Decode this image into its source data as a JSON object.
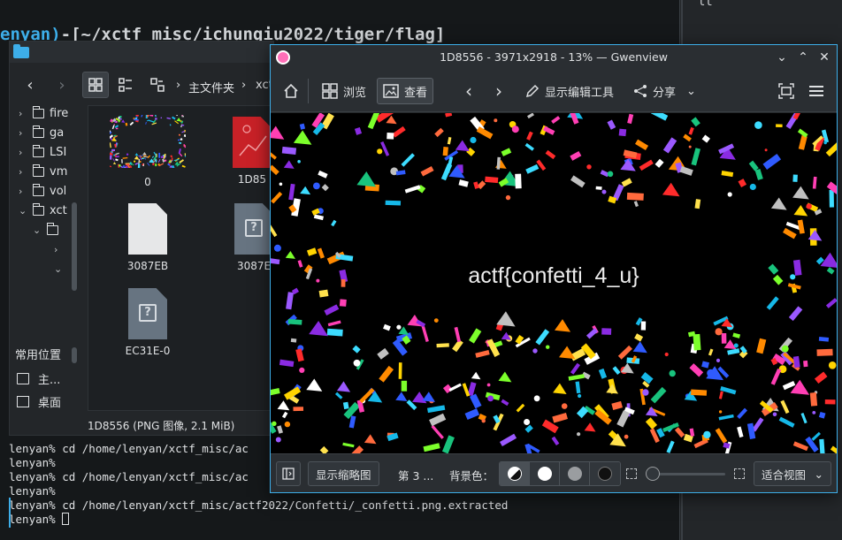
{
  "background_terminal": {
    "prompt_user": "enyan)",
    "prompt_path": "-[~/xctf_misc/ichunqiu2022/tiger/flag]",
    "right_pane_text": "lt"
  },
  "dolphin": {
    "breadcrumb_home": "主文件夹",
    "breadcrumb_next": "xct",
    "tree": [
      {
        "label": "fire",
        "expanded": false
      },
      {
        "label": "ga",
        "expanded": false
      },
      {
        "label": "LSI",
        "expanded": false
      },
      {
        "label": "vm",
        "expanded": false
      },
      {
        "label": "vol",
        "expanded": false
      },
      {
        "label": "xct",
        "expanded": true
      }
    ],
    "places_title": "常用位置",
    "places": [
      {
        "label": "主..."
      },
      {
        "label": "桌面"
      }
    ],
    "files": [
      {
        "name": "0",
        "kind": "thumbnail"
      },
      {
        "name": "1D85",
        "kind": "image-red"
      },
      {
        "name": "3087EB",
        "kind": "white-doc"
      },
      {
        "name": "3087E",
        "kind": "gray-unknown"
      },
      {
        "name": "EC31E-0",
        "kind": "gray-unknown"
      }
    ],
    "status": "1D8556 (PNG 图像, 2.1 MiB)"
  },
  "terminal": {
    "lines": [
      "lenyan%  cd /home/lenyan/xctf_misc/ac",
      "lenyan%",
      "lenyan%  cd /home/lenyan/xctf_misc/ac",
      "lenyan%",
      "lenyan%  cd /home/lenyan/xctf_misc/actf2022/Confetti/_confetti.png.extracted",
      "lenyan%"
    ]
  },
  "gwenview": {
    "title": "1D8556 - 3971x2918 - 13% — Gwenview",
    "toolbar": {
      "browse": "浏览",
      "view": "查看",
      "edit_tools": "显示编辑工具",
      "share": "分享"
    },
    "image_text": "actf{confetti_4_u}",
    "bottom": {
      "thumbnails": "显示缩略图",
      "page": "第 3 ...",
      "bg_label": "背景色：",
      "fit": "适合视图"
    },
    "colors": {
      "accent": "#3daee9",
      "canvas": "#000000"
    }
  }
}
